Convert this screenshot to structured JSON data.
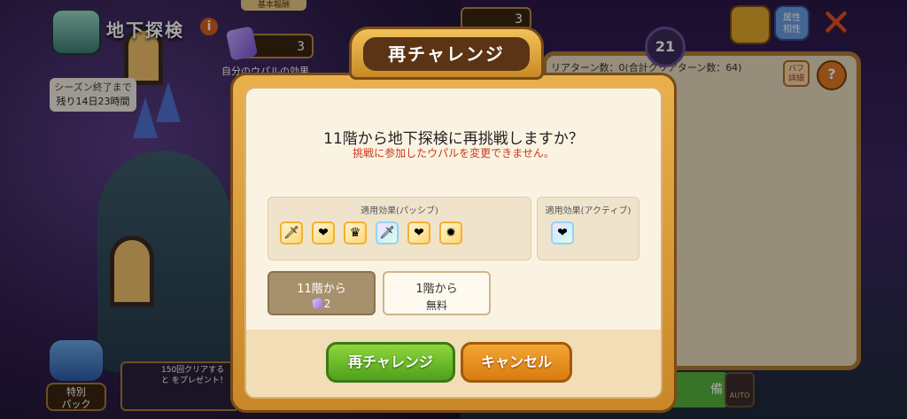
{
  "background": {
    "screen_title": "地下探検",
    "info_icon": "i",
    "basic_tab": "基本報酬",
    "gem_count": "3",
    "gem_count_right": "3",
    "my_upal_effect": "自分のウパルの効果",
    "season": {
      "line1": "シーズン終了まで",
      "line2": "残り14日23時間"
    },
    "floor_badge": "21",
    "attr_button": {
      "line1": "属性",
      "line2": "相性"
    },
    "close_icon": "✕",
    "clear_turns": "リアターン数：0(合計クリアターン数：64)",
    "buff_button": {
      "line1": "バフ",
      "line2": "詳細"
    },
    "help_button": "?",
    "special_pack": {
      "line1": "特別",
      "line2": "パック"
    },
    "bonus_text": "150回クリアすると をプレゼント！",
    "equip_button": "備",
    "auto_button": "AUTO"
  },
  "dialog": {
    "title": "再チャレンジ",
    "question": "11階から地下探検に再挑戦しますか？",
    "warning": "挑戦に参加したウパルを変更できません。",
    "passive_label": "適用効果(パッシブ)",
    "active_label": "適用効果(アクティブ)",
    "passive_icons": [
      "sword-icon",
      "heart-flower-icon",
      "crown-icon",
      "rainbow-sword-icon",
      "heart-flower-icon",
      "flame-icon"
    ],
    "active_icons": [
      "rainbow-heart-flower-icon"
    ],
    "option_11": {
      "label": "11階から",
      "cost": "2"
    },
    "option_1": {
      "label": "1階から",
      "cost": "無料"
    },
    "retry_button": "再チャレンジ",
    "cancel_button": "キャンセル"
  },
  "colors": {
    "accent_gold": "#e9b04c",
    "retry_green": "#4ea11b",
    "cancel_orange": "#d97b12",
    "warning_red": "#c8381e"
  }
}
